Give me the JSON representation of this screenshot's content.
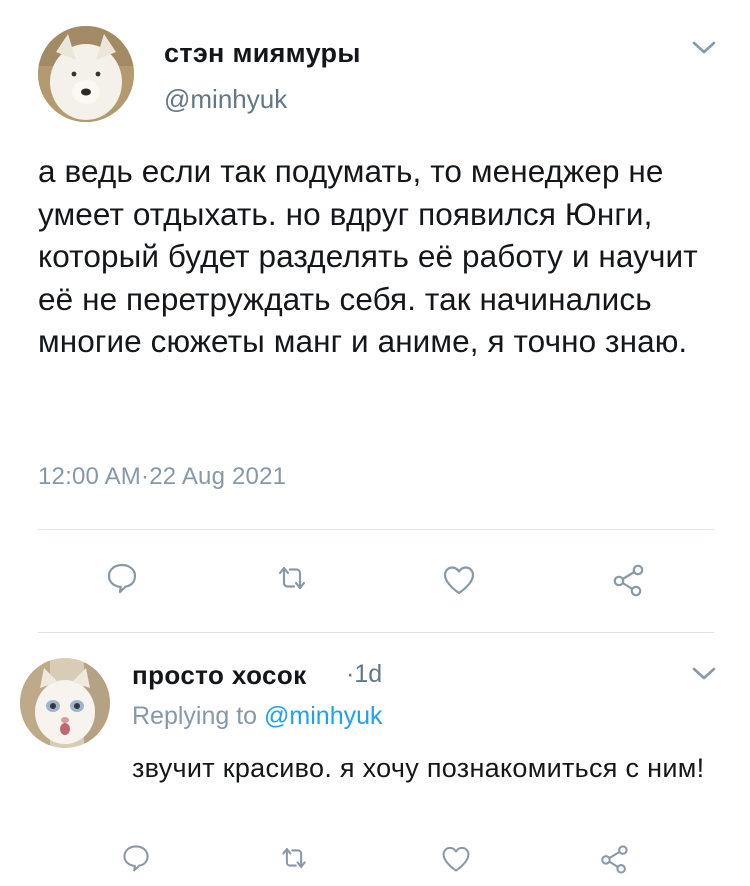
{
  "tweet": {
    "author_name": "стэн миямуры",
    "author_handle": "@minhyuk",
    "text": "а ведь если так подумать, то менеджер не умеет отдыхать. но вдруг появился Юнги, который будет разделять её работу и научит её не перетруждать себя. так начинались многие сюжеты манг и аниме, я точно знаю.",
    "timestamp": "12:00 AM·22 Aug 2021",
    "actions": [
      "reply-icon",
      "retweet-icon",
      "like-icon",
      "share-icon"
    ]
  },
  "reply": {
    "author_name": "просто хосок",
    "time_sep": "·",
    "time": "1d",
    "replying_label": "Replying to",
    "replying_handle": "@minhyuk",
    "text": "звучит красиво. я хочу познакомиться с ним!",
    "actions": [
      "reply-icon",
      "retweet-icon",
      "like-icon",
      "share-icon"
    ]
  },
  "colors": {
    "text_primary": "#14171a",
    "text_secondary": "#657786",
    "link": "#1da1f2",
    "icon": "#8899a6",
    "divider": "#dfe4e8"
  }
}
